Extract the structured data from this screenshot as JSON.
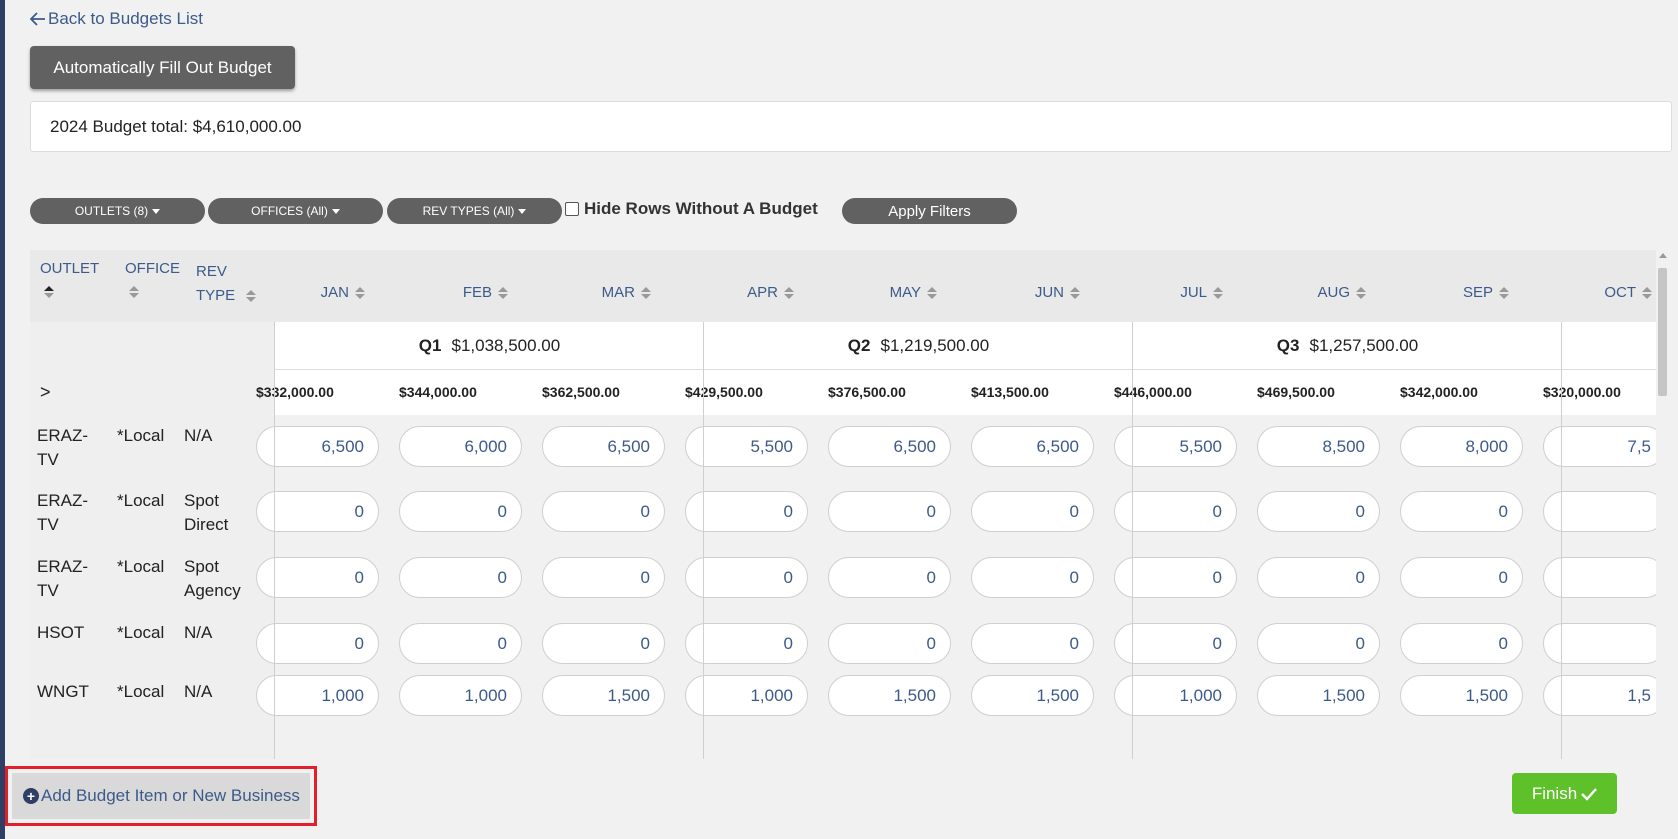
{
  "nav": {
    "back_label": "Back to Budgets List"
  },
  "actions": {
    "autofill_label": "Automatically Fill Out Budget"
  },
  "summary": {
    "total_text": "2024 Budget total: $4,610,000.00"
  },
  "filters": {
    "outlets_label": "OUTLETS (8)",
    "offices_label": "OFFICES (All)",
    "revtypes_label": "REV TYPES (All)",
    "hide_rows_label": "Hide Rows Without A Budget",
    "hide_rows_checked": false,
    "apply_label": "Apply Filters"
  },
  "table": {
    "headers": {
      "outlet": "OUTLET",
      "office": "OFFICE",
      "rev_type": "REV TYPE",
      "months": [
        "JAN",
        "FEB",
        "MAR",
        "APR",
        "MAY",
        "JUN",
        "JUL",
        "AUG",
        "SEP",
        "OCT"
      ]
    },
    "quarters": [
      {
        "label": "Q1",
        "total": "$1,038,500.00"
      },
      {
        "label": "Q2",
        "total": "$1,219,500.00"
      },
      {
        "label": "Q3",
        "total": "$1,257,500.00"
      }
    ],
    "expand_glyph": ">",
    "month_totals": [
      "$332,000.00",
      "$344,000.00",
      "$362,500.00",
      "$429,500.00",
      "$376,500.00",
      "$413,500.00",
      "$446,000.00",
      "$469,500.00",
      "$342,000.00",
      "$320,000.00"
    ],
    "rows": [
      {
        "outlet": "ERAZ-\nTV",
        "office": "*Local",
        "rev_type": "N/A",
        "values": [
          "6,500",
          "6,000",
          "6,500",
          "5,500",
          "6,500",
          "6,500",
          "5,500",
          "8,500",
          "8,000",
          "7,5"
        ]
      },
      {
        "outlet": "ERAZ-\nTV",
        "office": "*Local",
        "rev_type": "Spot\nDirect",
        "values": [
          "0",
          "0",
          "0",
          "0",
          "0",
          "0",
          "0",
          "0",
          "0",
          ""
        ]
      },
      {
        "outlet": "ERAZ-\nTV",
        "office": "*Local",
        "rev_type": "Spot\nAgency",
        "values": [
          "0",
          "0",
          "0",
          "0",
          "0",
          "0",
          "0",
          "0",
          "0",
          ""
        ]
      },
      {
        "outlet": "HSOT",
        "office": "*Local",
        "rev_type": "N/A",
        "values": [
          "0",
          "0",
          "0",
          "0",
          "0",
          "0",
          "0",
          "0",
          "0",
          ""
        ]
      },
      {
        "outlet": "WNGT",
        "office": "*Local",
        "rev_type": "N/A",
        "values": [
          "1,000",
          "1,000",
          "1,500",
          "1,000",
          "1,500",
          "1,500",
          "1,000",
          "1,500",
          "1,500",
          "1,5"
        ]
      }
    ]
  },
  "footer": {
    "add_item_label": "Add Budget Item or New Business",
    "finish_label": "Finish"
  },
  "colors": {
    "accent_blue": "#3c5a8a",
    "button_gray": "#616161",
    "finish_green": "#5ec12a",
    "highlight_red": "#e0202a"
  },
  "icons": [
    "arrow-left-icon",
    "caret-down-icon",
    "sort-icon",
    "chevron-right-icon",
    "plus-circle-icon",
    "check-icon"
  ]
}
